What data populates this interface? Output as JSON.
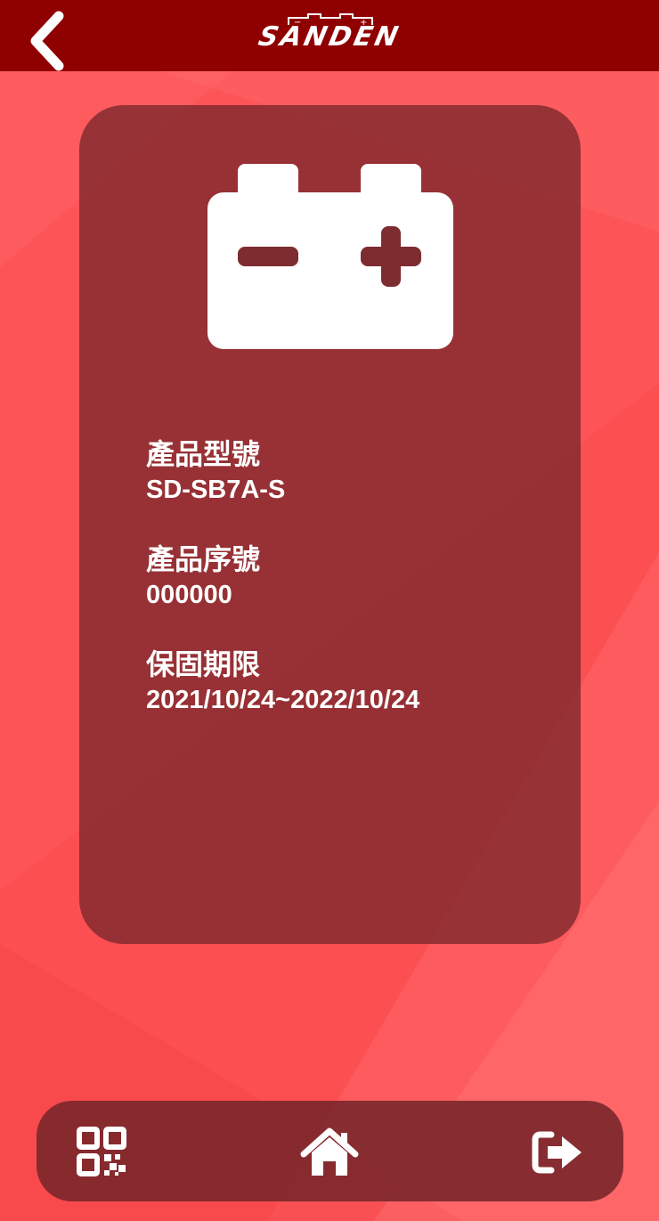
{
  "header": {
    "brand": "SANDEN",
    "back_icon": "chevron-left-icon"
  },
  "product": {
    "icon": "car-battery-icon",
    "fields": [
      {
        "label": "產品型號",
        "value": "SD-SB7A-S"
      },
      {
        "label": "產品序號",
        "value": "000000"
      },
      {
        "label": "保固期限",
        "value": "2021/10/24~2022/10/24"
      }
    ]
  },
  "bottom_nav": {
    "items": [
      {
        "icon": "qr-code-icon"
      },
      {
        "icon": "home-icon"
      },
      {
        "icon": "logout-icon"
      }
    ]
  },
  "colors": {
    "header": "#8f0000",
    "background": "#fb4f52",
    "card": "#7a282c",
    "text": "#ffffff"
  }
}
